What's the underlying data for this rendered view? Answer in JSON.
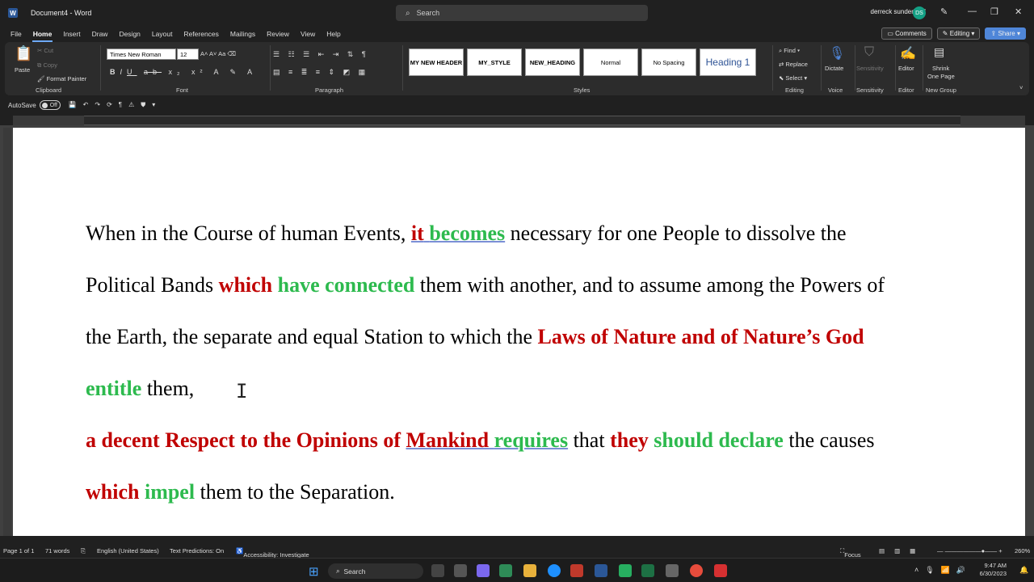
{
  "window": {
    "title": "Document4 - Word",
    "search_placeholder": "Search",
    "user": "derreck sunderland",
    "user_initials": "DS"
  },
  "tabs": [
    "File",
    "Home",
    "Insert",
    "Draw",
    "Design",
    "Layout",
    "References",
    "Mailings",
    "Review",
    "View",
    "Help"
  ],
  "active_tab": "Home",
  "menu_right": {
    "comments": "Comments",
    "editing": "Editing",
    "share": "Share"
  },
  "ribbon": {
    "clipboard": {
      "paste": "Paste",
      "cut": "Cut",
      "copy": "Copy",
      "format_painter": "Format Painter",
      "label": "Clipboard"
    },
    "font": {
      "name": "Times New Roman",
      "size": "12",
      "label": "Font"
    },
    "paragraph": {
      "label": "Paragraph"
    },
    "styles": {
      "items": [
        "MY NEW HEADER",
        "MY_STYLE",
        "NEW_HEADING",
        "Normal",
        "No Spacing",
        "Heading 1"
      ],
      "label": "Styles"
    },
    "editing": {
      "find": "Find",
      "replace": "Replace",
      "select": "Select",
      "label": "Editing"
    },
    "voice": {
      "dictate": "Dictate",
      "label": "Voice"
    },
    "sensitivity": {
      "button": "Sensitivity",
      "label": "Sensitivity"
    },
    "editor": {
      "button": "Editor",
      "label": "Editor"
    },
    "newgroup": {
      "shrink1": "Shrink",
      "shrink2": "One Page",
      "label": "New Group"
    }
  },
  "qat": {
    "autosave": "AutoSave",
    "toggle": "Off"
  },
  "document": {
    "line1": {
      "a": "When in the Course of human Events, ",
      "b": "it",
      "c": "becomes",
      "d": " necessary for one People to dissolve the"
    },
    "line2": {
      "a": "Political Bands ",
      "b": "which",
      "c": "have connected",
      "d": " them with  another, and to assume among the Powers of"
    },
    "line3": {
      "a": "the  Earth, the separate and equal Station to which the  ",
      "b": "Laws of Nature and of Nature’s God"
    },
    "line4": {
      "a": "entitle",
      "b": " them,"
    },
    "line5": {
      "a": "a decent Respect to the Opinions of ",
      "b": "Mankind",
      "c": "requires",
      "d": " that ",
      "e": "they",
      "f": "should declare",
      "g": " the causes"
    },
    "line6": {
      "a": "which",
      "b": "impel",
      "c": " them to the Separation."
    }
  },
  "status": {
    "page": "Page 1 of 1",
    "words": "71 words",
    "language": "English (United States)",
    "predictions": "Text Predictions: On",
    "accessibility": "Accessibility: Investigate",
    "focus": "Focus",
    "zoom": "260%"
  },
  "taskbar": {
    "search": "Search",
    "time": "9:47 AM",
    "date": "6/30/2023"
  }
}
